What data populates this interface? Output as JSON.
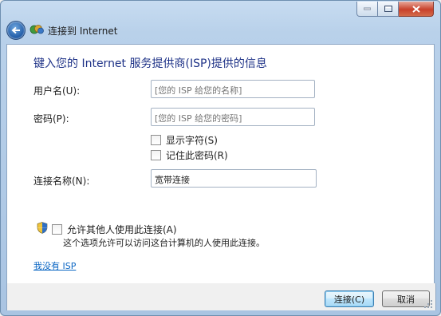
{
  "window": {
    "title": "连接到 Internet",
    "caption_buttons": {
      "minimize": "minimize-icon",
      "maximize": "maximize-icon",
      "close": "close-icon"
    }
  },
  "form": {
    "heading": "键入您的 Internet 服务提供商(ISP)提供的信息",
    "username": {
      "label": "用户名(U):",
      "placeholder": "[您的 ISP 给您的名称]",
      "value": ""
    },
    "password": {
      "label": "密码(P):",
      "placeholder": "[您的 ISP 给您的密码]",
      "value": ""
    },
    "show_chars": {
      "label": "显示字符(S)",
      "checked": false
    },
    "remember_pw": {
      "label": "记住此密码(R)",
      "checked": false
    },
    "conn_name": {
      "label": "连接名称(N):",
      "value": "宽带连接"
    },
    "allow_others": {
      "label": "允许其他人使用此连接(A)",
      "checked": false,
      "note": "这个选项允许可以访问这台计算机的人使用此连接。"
    },
    "no_isp_link": "我没有 ISP"
  },
  "footer": {
    "connect_label": "连接(C)",
    "cancel_label": "取消"
  },
  "colors": {
    "heading": "#1e3287",
    "link": "#0b66c3",
    "accent": "#3c7fb1"
  }
}
